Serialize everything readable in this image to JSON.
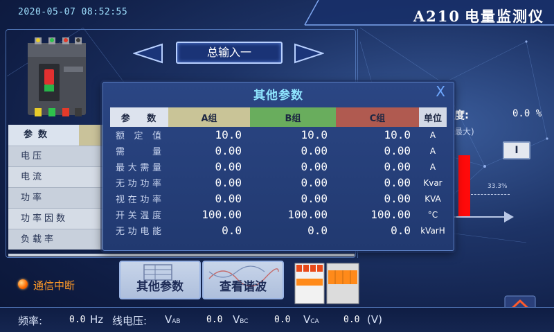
{
  "header": {
    "datetime": "2020-05-07  08:52:55",
    "model_code": "A210",
    "title": "电量监测仪"
  },
  "nav": {
    "current": "总输入一"
  },
  "background_table": {
    "header": "参数",
    "rows": [
      "电压",
      "电流",
      "功率",
      "功率因数",
      "负载率"
    ]
  },
  "right_panel": {
    "label_partial": "度:",
    "value": "0.0 %",
    "sub_partial": "最大)",
    "button": "I",
    "bar_fraction": 0.88,
    "reference_label": "33.3%"
  },
  "modal": {
    "title": "其他参数",
    "close_glyph": "X",
    "columns": {
      "param": "参  数",
      "a": "A组",
      "b": "B组",
      "c": "C组",
      "unit": "单位"
    },
    "rows": [
      {
        "label": "额定值",
        "a": "10.0",
        "b": "10.0",
        "c": "10.0",
        "unit": "A"
      },
      {
        "label": "需量",
        "a": "0.00",
        "b": "0.00",
        "c": "0.00",
        "unit": "A"
      },
      {
        "label": "最大需量",
        "a": "0.00",
        "b": "0.00",
        "c": "0.00",
        "unit": "A"
      },
      {
        "label": "无功功率",
        "a": "0.00",
        "b": "0.00",
        "c": "0.00",
        "unit": "Kvar"
      },
      {
        "label": "视在功率",
        "a": "0.00",
        "b": "0.00",
        "c": "0.00",
        "unit": "KVA"
      },
      {
        "label": "开关温度",
        "a": "100.00",
        "b": "100.00",
        "c": "100.00",
        "unit": "°C"
      },
      {
        "label": "无功电能",
        "a": "0.0",
        "b": "0.0",
        "c": "0.0",
        "unit": "kVarH"
      }
    ]
  },
  "buttons": {
    "other_params": "其他参数",
    "view_harmonics": "查看谐波"
  },
  "status": {
    "comm": "通信中断",
    "color": "#ff9a28"
  },
  "footer": {
    "freq_label": "频率:",
    "freq_value": "0.0",
    "freq_unit": "Hz",
    "line_voltage_label": "线电压:",
    "vab_label": "V",
    "vab_sub": "AB",
    "vab_value": "0.0",
    "vbc_label": "V",
    "vbc_sub": "BC",
    "vbc_value": "0.0",
    "vca_label": "V",
    "vca_sub": "CA",
    "vca_value": "0.0",
    "volt_unit": "(V)"
  },
  "icons": [
    "prev-arrow-icon",
    "next-arrow-icon",
    "close-icon",
    "home-icon",
    "breaker-image",
    "surge-protector-image",
    "status-dot-icon"
  ]
}
